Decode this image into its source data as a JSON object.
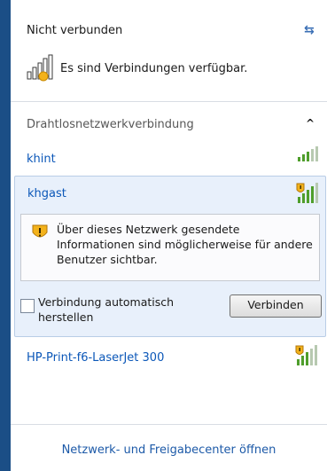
{
  "header": {
    "title": "Nicht verbunden",
    "status": "Es sind Verbindungen verfügbar."
  },
  "section": {
    "title": "Drahtlosnetzwerkverbindung"
  },
  "networks": [
    {
      "name": "khint",
      "icon": "signal-icon"
    },
    {
      "name": "khgast",
      "icon": "signal-warning-icon",
      "warning": "Über dieses Netzwerk gesendete Informationen sind möglicherweise für andere Benutzer sichtbar.",
      "auto_connect_label": "Verbindung automatisch herstellen",
      "auto_connect_checked": false,
      "connect_label": "Verbinden"
    },
    {
      "name": "HP-Print-f6-LaserJet 300",
      "icon": "signal-warning-icon"
    }
  ],
  "footer": {
    "link": "Netzwerk- und Freigabecenter öffnen"
  },
  "colors": {
    "link": "#0b57b8",
    "panel_border": "#1b4e86",
    "selected_bg": "#e8f0fb"
  }
}
